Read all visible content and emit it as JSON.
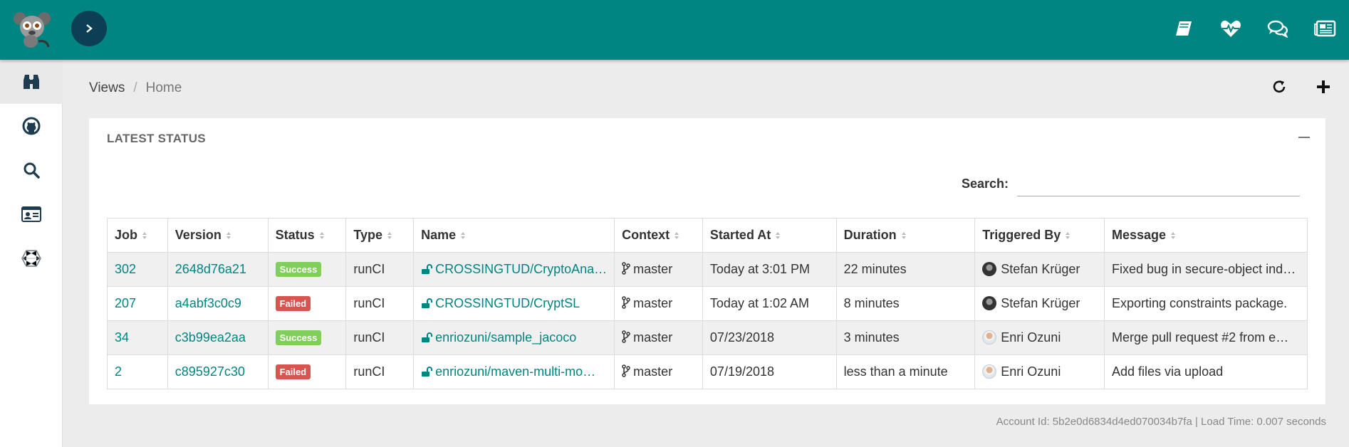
{
  "topbar": {
    "brand_color": "#008582",
    "icons": [
      "book-icon",
      "heartbeat-icon",
      "comments-icon",
      "newspaper-icon"
    ]
  },
  "sidebar": {
    "items": [
      {
        "icon": "binoculars-icon",
        "active": true
      },
      {
        "icon": "github-icon",
        "active": false
      },
      {
        "icon": "search-icon",
        "active": false
      },
      {
        "icon": "id-card-icon",
        "active": false
      },
      {
        "icon": "hexagon-icon",
        "active": false
      }
    ]
  },
  "breadcrumb": {
    "items": [
      "Views",
      "Home"
    ]
  },
  "panel": {
    "title": "LATEST STATUS",
    "search_label": "Search:",
    "search_value": ""
  },
  "table": {
    "headers": [
      "Job",
      "Version",
      "Status",
      "Type",
      "Name",
      "Context",
      "Started At",
      "Duration",
      "Triggered By",
      "Message"
    ],
    "rows": [
      {
        "job": "302",
        "version": "2648d76a21",
        "status": "Success",
        "type": "runCI",
        "name": "CROSSINGTUD/CryptoAna…",
        "context": "master",
        "started_at": "Today at 3:01 PM",
        "duration": "22 minutes",
        "triggered_by": "Stefan Krüger",
        "message": "Fixed bug in secure-object ind…"
      },
      {
        "job": "207",
        "version": "a4abf3c0c9",
        "status": "Failed",
        "type": "runCI",
        "name": "CROSSINGTUD/CryptSL",
        "context": "master",
        "started_at": "Today at 1:02 AM",
        "duration": "8 minutes",
        "triggered_by": "Stefan Krüger",
        "message": "Exporting constraints package."
      },
      {
        "job": "34",
        "version": "c3b99ea2aa",
        "status": "Success",
        "type": "runCI",
        "name": "enriozuni/sample_jacoco",
        "context": "master",
        "started_at": "07/23/2018",
        "duration": "3 minutes",
        "triggered_by": "Enri Ozuni",
        "message": "Merge pull request #2 from e…"
      },
      {
        "job": "2",
        "version": "c895927c30",
        "status": "Failed",
        "type": "runCI",
        "name": "enriozuni/maven-multi-mo…",
        "context": "master",
        "started_at": "07/19/2018",
        "duration": "less than a minute",
        "triggered_by": "Enri Ozuni",
        "message": "Add files via upload"
      }
    ]
  },
  "footer": {
    "text": "Account Id: 5b2e0d6834d4ed070034b7fa | Load Time: 0.007 seconds"
  }
}
